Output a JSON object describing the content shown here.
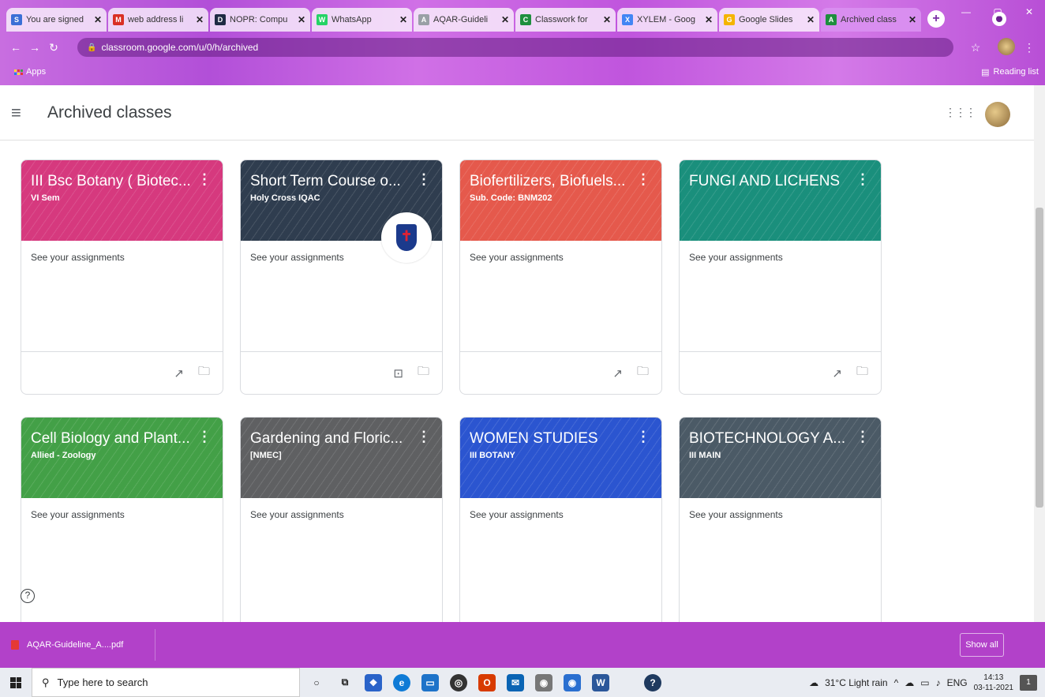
{
  "browser": {
    "tabs": [
      {
        "label": "You are signed",
        "icon": "S",
        "color": "#3b6fd6"
      },
      {
        "label": "web address li",
        "icon": "M",
        "color": "#d93025"
      },
      {
        "label": "NOPR: Compu",
        "icon": "D",
        "color": "#1f2a44"
      },
      {
        "label": "WhatsApp",
        "icon": "W",
        "color": "#25d366"
      },
      {
        "label": "AQAR-Guideli",
        "icon": "A",
        "color": "#9aa0a6"
      },
      {
        "label": "Classwork for",
        "icon": "C",
        "color": "#1e8e3e"
      },
      {
        "label": "XYLEM - Goog",
        "icon": "X",
        "color": "#4285f4"
      },
      {
        "label": "Google Slides",
        "icon": "G",
        "color": "#f4b400"
      },
      {
        "label": "Archived class",
        "icon": "A",
        "color": "#1e8e3e",
        "active": true
      }
    ],
    "url": "classroom.google.com/u/0/h/archived",
    "bookmarks_apps": "Apps",
    "reading_list": "Reading list"
  },
  "header": {
    "title": "Archived classes"
  },
  "classes": [
    {
      "title": "III Bsc Botany ( Biotec...",
      "subtitle": "VI Sem",
      "body": "See your assignments",
      "color": "#d6397e",
      "footer": [
        "trend",
        "folder"
      ]
    },
    {
      "title": "Short Term Course o...",
      "subtitle": "Holy Cross IQAC",
      "body": "See your assignments",
      "color": "#2f3d4f",
      "footer": [
        "portrait",
        "folder"
      ],
      "badge": true
    },
    {
      "title": "Biofertilizers, Biofuels...",
      "subtitle": "Sub. Code: BNM202",
      "body": "See your assignments",
      "color": "#e5594c",
      "footer": [
        "trend",
        "folder"
      ]
    },
    {
      "title": "FUNGI AND LICHENS",
      "subtitle": "",
      "body": "See your assignments",
      "color": "#1a8f7c",
      "footer": [
        "trend",
        "folder"
      ]
    },
    {
      "title": "Cell Biology and Plant...",
      "subtitle": "Allied - Zoology",
      "body": "See your assignments",
      "color": "#43a047",
      "footer": []
    },
    {
      "title": "Gardening and Floric...",
      "subtitle": "[NMEC]",
      "body": "See your assignments",
      "color": "#5f6062",
      "footer": []
    },
    {
      "title": "WOMEN STUDIES",
      "subtitle": "III BOTANY",
      "body": "See your assignments",
      "color": "#2b55d0",
      "footer": []
    },
    {
      "title": "BIOTECHNOLOGY A...",
      "subtitle": "III MAIN",
      "body": "See your assignments",
      "color": "#4b5a66",
      "footer": []
    }
  ],
  "download": {
    "file": "AQAR-Guideline_A....pdf",
    "show_all": "Show all"
  },
  "taskbar": {
    "search_placeholder": "Type here to search",
    "weather": "31°C Light rain",
    "lang": "ENG",
    "time": "14:13",
    "date": "03-11-2021",
    "notifications": "1"
  }
}
